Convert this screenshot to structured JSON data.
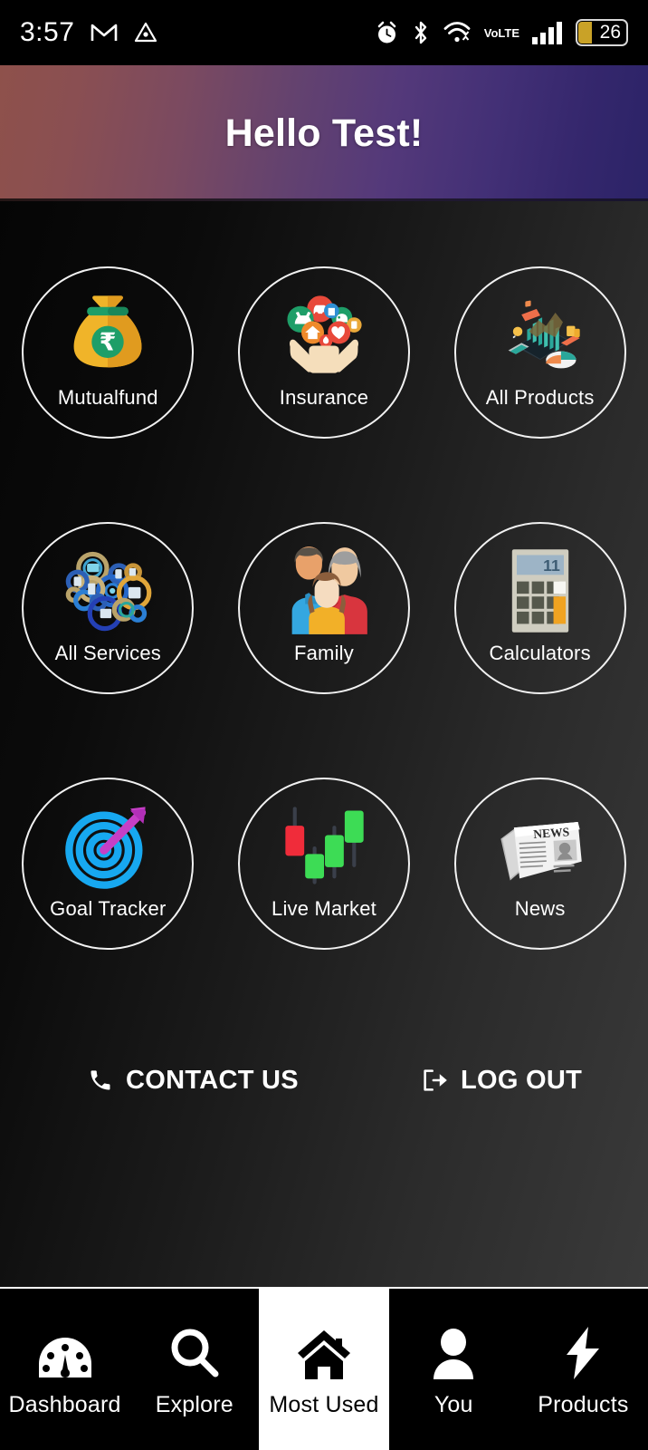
{
  "status_bar": {
    "time": "3:57",
    "left_icons": [
      "gmail-icon",
      "adobe-triangle-icon"
    ],
    "right_icons": [
      "alarm-icon",
      "bluetooth-icon",
      "wifi-icon",
      "volte-icon",
      "signal-icon"
    ],
    "volte_top": "Vo",
    "volte_bottom": "LTE",
    "battery_percent": "26"
  },
  "header": {
    "title": "Hello Test!",
    "gradient_start": "#8e514b",
    "gradient_end": "#2b2367"
  },
  "grid": {
    "tiles": [
      {
        "label": "Mutualfund",
        "icon": "money-bag-rupee-icon"
      },
      {
        "label": "Insurance",
        "icon": "hands-holding-insurance-icons"
      },
      {
        "label": "All Products",
        "icon": "isometric-analytics-icon"
      },
      {
        "label": "All Services",
        "icon": "gears-cluster-icon"
      },
      {
        "label": "Family",
        "icon": "family-people-icon"
      },
      {
        "label": "Calculators",
        "icon": "calculator-icon"
      },
      {
        "label": "Goal Tracker",
        "icon": "target-arrow-icon"
      },
      {
        "label": "Live Market",
        "icon": "candlestick-chart-icon"
      },
      {
        "label": "News",
        "icon": "newspaper-icon"
      }
    ]
  },
  "actions": {
    "contact_label": "CONTACT US",
    "contact_icon": "phone-icon",
    "logout_label": "LOG OUT",
    "logout_icon": "sign-out-icon"
  },
  "bottom_nav": {
    "active_index": 2,
    "items": [
      {
        "label": "Dashboard",
        "icon": "speedometer-icon"
      },
      {
        "label": "Explore",
        "icon": "search-icon"
      },
      {
        "label": "Most Used",
        "icon": "home-icon"
      },
      {
        "label": "You",
        "icon": "person-icon"
      },
      {
        "label": "Products",
        "icon": "lightning-bolt-icon"
      }
    ]
  },
  "colors": {
    "accent_gold": "#eeab2d",
    "accent_green": "#1e9e68",
    "market_up": "#3ddc55",
    "market_down": "#f02c3a",
    "target_blue": "#17a8f0",
    "arrow_magenta": "#c63fc6"
  }
}
